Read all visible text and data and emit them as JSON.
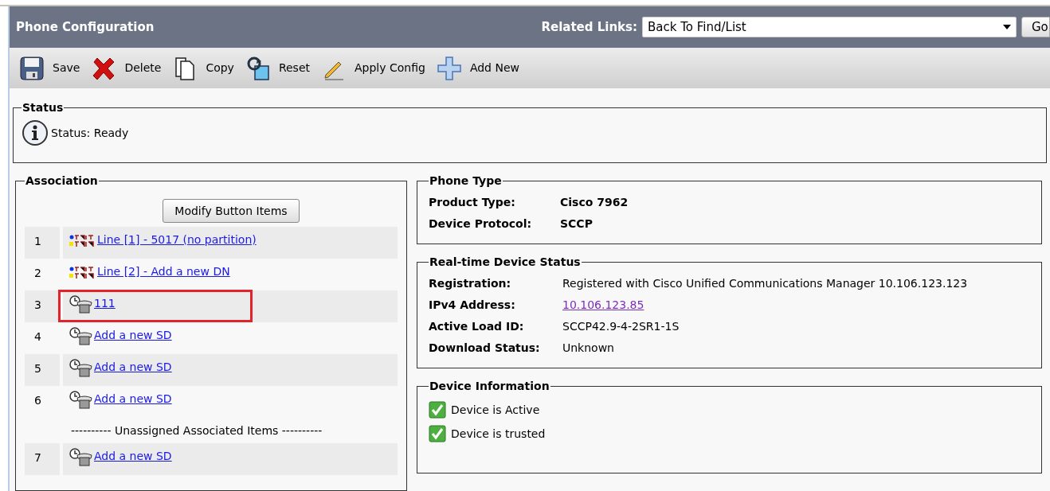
{
  "header": {
    "title": "Phone Configuration",
    "related_links_label": "Related Links:",
    "related_links_value": "Back To Find/List",
    "go_button": "Go"
  },
  "toolbar": [
    {
      "kind": "save",
      "label": "Save"
    },
    {
      "kind": "delete",
      "label": "Delete"
    },
    {
      "kind": "copy",
      "label": "Copy"
    },
    {
      "kind": "reset",
      "label": "Reset"
    },
    {
      "kind": "apply",
      "label": "Apply Config"
    },
    {
      "kind": "add",
      "label": "Add New"
    }
  ],
  "status": {
    "legend": "Status",
    "text": "Status: Ready"
  },
  "association": {
    "legend": "Association",
    "modify_button": "Modify Button Items",
    "items": [
      {
        "number": "1",
        "kind": "line",
        "label": "Line [1] - 5017 (no partition)",
        "highlighted": false
      },
      {
        "number": "2",
        "kind": "line",
        "label": "Line [2] - Add a new DN",
        "highlighted": false
      },
      {
        "number": "3",
        "kind": "speed_dial",
        "label": "111",
        "highlighted": true
      },
      {
        "number": "4",
        "kind": "speed_dial",
        "label": "Add a new SD",
        "highlighted": false
      },
      {
        "number": "5",
        "kind": "speed_dial",
        "label": "Add a new SD",
        "highlighted": false
      },
      {
        "number": "6",
        "kind": "speed_dial",
        "label": "Add a new SD",
        "highlighted": false
      }
    ],
    "unassigned_heading": "---------- Unassigned Associated Items ----------",
    "unassigned_items": [
      {
        "number": "7",
        "kind": "speed_dial",
        "label": "Add a new SD",
        "highlighted": false
      }
    ]
  },
  "phone_type": {
    "legend": "Phone Type",
    "fields": [
      {
        "label": "Product Type:",
        "value": "Cisco 7962"
      },
      {
        "label": "Device Protocol:",
        "value": "SCCP"
      }
    ]
  },
  "realtime_status": {
    "legend": "Real-time Device Status",
    "fields": [
      {
        "label": "Registration:",
        "value": "Registered with Cisco Unified Communications Manager 10.106.123.123",
        "kind": "text"
      },
      {
        "label": "IPv4 Address:",
        "value": "10.106.123.85",
        "kind": "link"
      },
      {
        "label": "Active Load ID:",
        "value": "SCCP42.9-4-2SR1-1S",
        "kind": "text"
      },
      {
        "label": "Download Status:",
        "value": "Unknown",
        "kind": "text"
      }
    ]
  },
  "device_information": {
    "legend": "Device Information",
    "checks": [
      {
        "label": "Device is Active",
        "checked": true
      },
      {
        "label": "Device is trusted",
        "checked": true
      }
    ]
  }
}
